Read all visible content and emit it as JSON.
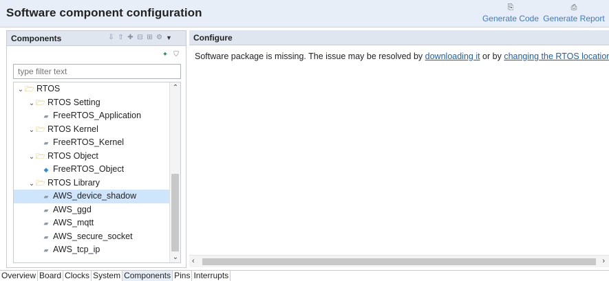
{
  "header": {
    "title": "Software component configuration",
    "generate_code": "Generate Code",
    "generate_report": "Generate Report"
  },
  "components": {
    "title": "Components",
    "filter_placeholder": "type filter text",
    "tree": [
      {
        "label": "RTOS",
        "type": "folder",
        "level": 0,
        "expanded": true
      },
      {
        "label": "RTOS Setting",
        "type": "folder",
        "level": 1,
        "expanded": true
      },
      {
        "label": "FreeRTOS_Application",
        "type": "leaf",
        "level": 2
      },
      {
        "label": "RTOS Kernel",
        "type": "folder",
        "level": 1,
        "expanded": true
      },
      {
        "label": "FreeRTOS_Kernel",
        "type": "leaf",
        "level": 2
      },
      {
        "label": "RTOS Object",
        "type": "folder",
        "level": 1,
        "expanded": true
      },
      {
        "label": "FreeRTOS_Object",
        "type": "leaf-blue",
        "level": 2
      },
      {
        "label": "RTOS Library",
        "type": "folder",
        "level": 1,
        "expanded": true
      },
      {
        "label": "AWS_device_shadow",
        "type": "leaf",
        "level": 2,
        "selected": true
      },
      {
        "label": "AWS_ggd",
        "type": "leaf",
        "level": 2
      },
      {
        "label": "AWS_mqtt",
        "type": "leaf",
        "level": 2
      },
      {
        "label": "AWS_secure_socket",
        "type": "leaf",
        "level": 2
      },
      {
        "label": "AWS_tcp_ip",
        "type": "leaf",
        "level": 2
      }
    ]
  },
  "configure": {
    "title": "Configure",
    "message_prefix": "Software package is missing. The issue may be resolved by ",
    "link_download": "downloading it",
    "message_middle": " or by ",
    "link_change": "changing the RTOS location"
  },
  "tabs": [
    "Overview",
    "Board",
    "Clocks",
    "System",
    "Components",
    "Pins",
    "Interrupts"
  ],
  "active_tab": "Components",
  "colors": {
    "link": "#1a5fb4",
    "accent": "#3d79c4",
    "selection": "#cfe5fb"
  }
}
